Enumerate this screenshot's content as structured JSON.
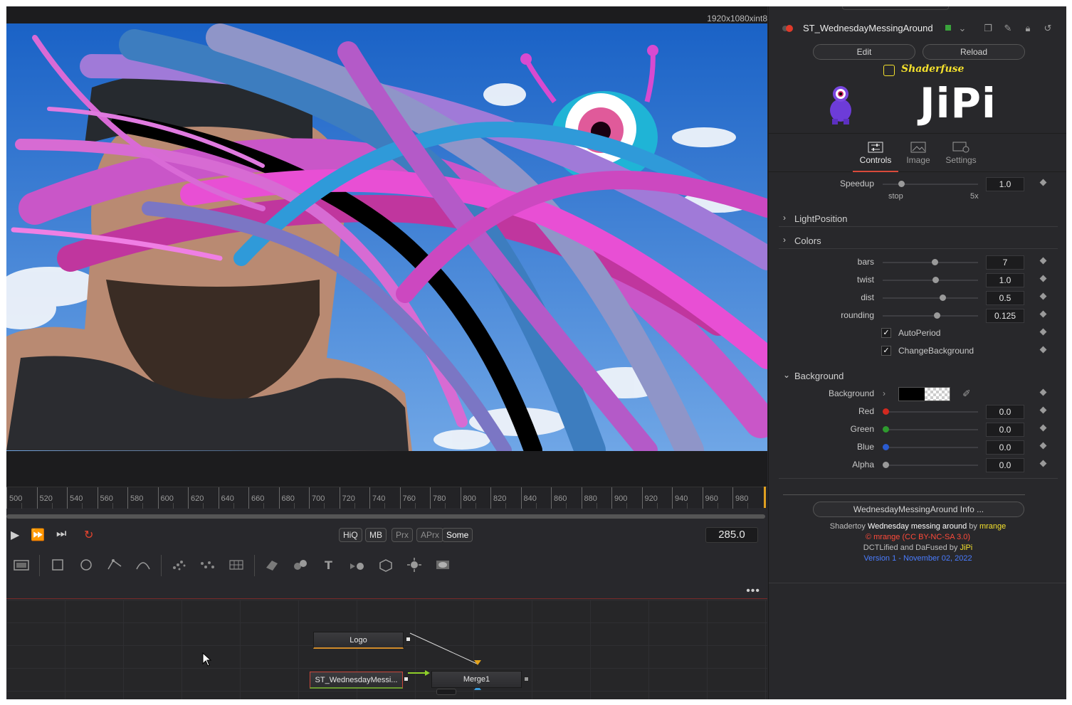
{
  "viewer": {
    "resolution_label": "1920x1080xint8"
  },
  "ruler": {
    "ticks": [
      "500",
      "520",
      "540",
      "560",
      "580",
      "600",
      "620",
      "640",
      "660",
      "680",
      "700",
      "720",
      "740",
      "760",
      "780",
      "800",
      "820",
      "840",
      "860",
      "880",
      "900",
      "920",
      "940",
      "960",
      "980"
    ]
  },
  "transport": {
    "quality_buttons": [
      "HiQ",
      "MB",
      "Prx",
      "APrx",
      "Some"
    ],
    "current_frame": "285.0"
  },
  "toolbar": {
    "tools": [
      "background-tool",
      "rectangle-mask",
      "ellipse-mask",
      "polygon-mask",
      "bspline-mask",
      "particle-emitter",
      "particle-render",
      "pixel-tool",
      "shape3d-tool",
      "merge3d-tool",
      "text3d-tool",
      "camera3d-tool",
      "imageplane3d-tool",
      "light-tool",
      "renderer3d-tool"
    ]
  },
  "node_graph": {
    "more_label": "•••",
    "nodes": {
      "logo": "Logo",
      "shader": "ST_WednesdayMessi...",
      "merge": "Merge1"
    }
  },
  "inspector": {
    "tool_name": "ST_WednesdayMessingAround",
    "edit_label": "Edit",
    "reload_label": "Reload",
    "brand": "Shaderfuse",
    "logo_text": "JiPi",
    "tabs": [
      "Controls",
      "Image",
      "Settings"
    ],
    "active_tab": "Controls",
    "speedup": {
      "label": "Speedup",
      "value": "1.0",
      "min_label": "stop",
      "max_label": "5x",
      "fraction": 0.2
    },
    "sections": {
      "light_position": "LightPosition",
      "colors": "Colors",
      "background": "Background"
    },
    "params": [
      {
        "label": "bars",
        "value": "7",
        "fraction": 0.54
      },
      {
        "label": "twist",
        "value": "1.0",
        "fraction": 0.55
      },
      {
        "label": "dist",
        "value": "0.5",
        "fraction": 0.62
      },
      {
        "label": "rounding",
        "value": "0.125",
        "fraction": 0.56
      }
    ],
    "checkboxes": [
      {
        "label": "AutoPeriod",
        "checked": true
      },
      {
        "label": "ChangeBackground",
        "checked": true
      }
    ],
    "background_label": "Background",
    "color_channels": [
      {
        "label": "Red",
        "value": "0.0",
        "color": "#d2291f"
      },
      {
        "label": "Green",
        "value": "0.0",
        "color": "#2e9a2e"
      },
      {
        "label": "Blue",
        "value": "0.0",
        "color": "#2a5bd0"
      },
      {
        "label": "Alpha",
        "value": "0.0",
        "color": "#9a9a9a"
      }
    ],
    "info_button": "WednesdayMessingAround Info ...",
    "info": {
      "line1_prefix": "Shadertoy",
      "line1_title": "Wednesday messing around",
      "line1_by": "by",
      "line1_author": "mrange",
      "line2": "© mrange (CC BY-NC-SA 3.0)",
      "line3_prefix": "DCTLified and DaFused by",
      "line3_author": "JiPi",
      "line4": "Version 1 - November 02, 2022"
    }
  },
  "colors": {
    "accent_red": "#d94a3a",
    "brand_yellow": "#f3e02d",
    "link_blue": "#4a7cff",
    "license_red": "#ff4a3a"
  }
}
